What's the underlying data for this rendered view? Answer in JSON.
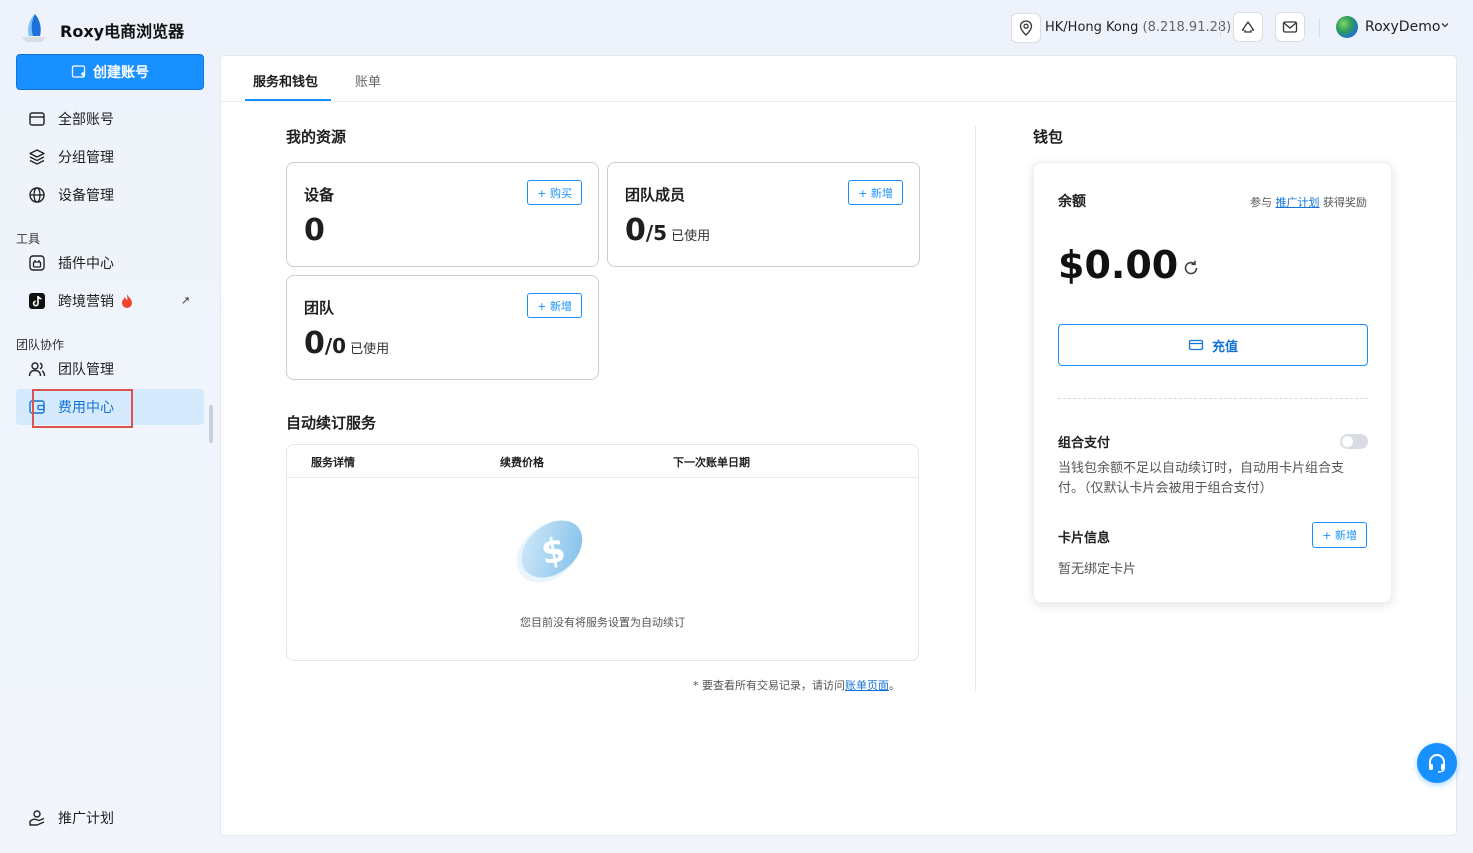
{
  "app": {
    "title": "Roxy电商浏览器"
  },
  "header": {
    "location_name": "HK/Hong Kong",
    "location_ip": "(8.218.91.28)",
    "user_name": "RoxyDemo"
  },
  "sidebar": {
    "create_label": "创建账号",
    "items_main": [
      {
        "label": "全部账号",
        "icon": "credit-card-icon"
      },
      {
        "label": "分组管理",
        "icon": "layers-icon"
      },
      {
        "label": "设备管理",
        "icon": "globe-icon"
      }
    ],
    "tools_section": "工具",
    "items_tools": [
      {
        "label": "插件中心",
        "icon": "plugin-icon"
      },
      {
        "label": "跨境营销",
        "icon": "tiktok-icon"
      }
    ],
    "team_section": "团队协作",
    "items_team": [
      {
        "label": "团队管理",
        "icon": "users-icon"
      },
      {
        "label": "费用中心",
        "icon": "wallet-icon",
        "active": true
      }
    ],
    "bottom_item": {
      "label": "推广计划",
      "icon": "handshake-icon"
    }
  },
  "tabs": [
    {
      "label": "服务和钱包",
      "active": true
    },
    {
      "label": "账单",
      "active": false
    }
  ],
  "resources": {
    "title": "我的资源",
    "devices": {
      "label": "设备",
      "count": "0",
      "button": "+ 购买"
    },
    "members": {
      "label": "团队成员",
      "count": "0",
      "total": "/5",
      "used": "已使用",
      "button": "+ 新增"
    },
    "teams": {
      "label": "团队",
      "count": "0",
      "total": "/0",
      "used": "已使用",
      "button": "+ 新增"
    }
  },
  "auto_renew": {
    "title": "自动续订服务",
    "columns": [
      "服务详情",
      "续费价格",
      "下一次账单日期"
    ],
    "empty_text": "您目前没有将服务设置为自动续订",
    "footnote_prefix": "* 要查看所有交易记录，请访问",
    "footnote_link": "账单页面",
    "footnote_suffix": "。"
  },
  "wallet": {
    "title": "钱包",
    "balance_label": "余额",
    "ref_prefix": "参与",
    "ref_link": "推广计划",
    "ref_suffix": "获得奖励",
    "balance": "$0.00",
    "topup_label": "充值",
    "combo_title": "组合支付",
    "combo_enabled": false,
    "combo_desc": "当钱包余额不足以自动续订时，自动用卡片组合支付。（仅默认卡片会被用于组合支付）",
    "card_title": "卡片信息",
    "card_button": "+ 新增",
    "card_empty": "暂无绑定卡片"
  },
  "colors": {
    "primary": "#1890ff",
    "active_bg": "#d6eafe",
    "highlight": "#d9534f"
  }
}
